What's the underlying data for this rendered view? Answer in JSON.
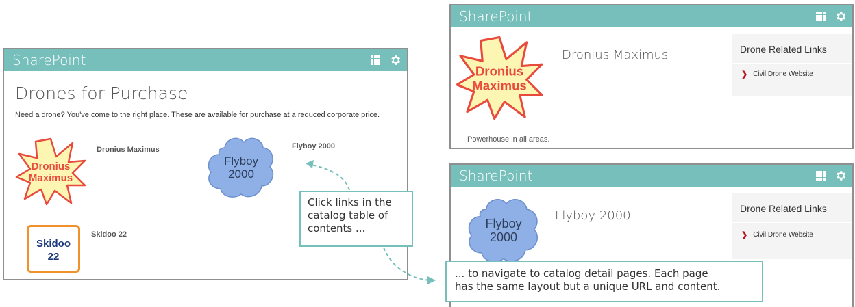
{
  "brand": "SharePoint",
  "colors": {
    "header": "#76bfbb",
    "accent": "#e84a3c",
    "chevron": "#b5121b",
    "callout_border": "#76bfbb"
  },
  "main": {
    "title": "Drones for Purchase",
    "description": "Need a drone? You've come to the right place. These are available for purchase at a reduced corporate price.",
    "items": [
      {
        "label": "Dronius Maximus",
        "image_text": [
          "Dronius",
          "Maximus"
        ]
      },
      {
        "label": "Flyboy 2000",
        "image_text": [
          "Flyboy",
          "2000"
        ]
      },
      {
        "label": "Skidoo 22",
        "image_text": [
          "Skidoo",
          "22"
        ]
      }
    ]
  },
  "callouts": {
    "left_lines": [
      "Click links in the",
      "catalog table of",
      "contents ..."
    ],
    "bottom_lines": [
      "... to navigate to catalog detail pages. Each page",
      "has the same layout but a unique URL and content."
    ]
  },
  "details": [
    {
      "name": "Dronius Maximus",
      "image_text": [
        "Dronius",
        "Maximus"
      ],
      "caption": "Powerhouse in all areas.",
      "links_title": "Drone Related Links",
      "link": "Civil Drone Website"
    },
    {
      "name": "Flyboy 2000",
      "image_text": [
        "Flyboy",
        "2000"
      ],
      "links_title": "Drone Related Links",
      "link": "Civil Drone Website"
    }
  ],
  "icons": {
    "waffle": "app-launcher-icon",
    "settings": "gear-icon",
    "chevron": "chevron-right-icon"
  }
}
